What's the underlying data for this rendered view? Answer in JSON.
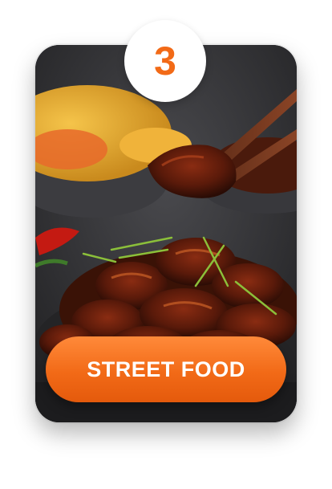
{
  "badge": {
    "number": "3",
    "color": "#f26a17"
  },
  "card": {
    "image": "dish-photo"
  },
  "cta": {
    "label": "STREET FOOD",
    "color": "#f26a17"
  }
}
